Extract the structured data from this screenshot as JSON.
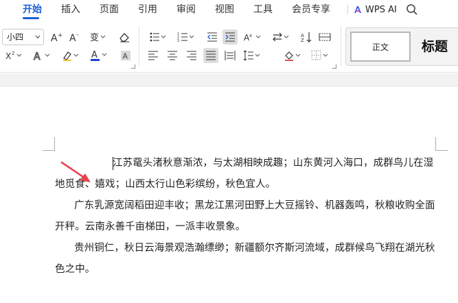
{
  "menu": {
    "tabs": [
      "开始",
      "插入",
      "页面",
      "引用",
      "审阅",
      "视图",
      "工具",
      "会员专享"
    ],
    "active_tab": "开始",
    "ai_label": "WPS AI"
  },
  "ribbon": {
    "font_size": "小四",
    "styles": {
      "normal": "正文",
      "heading": "标题"
    }
  },
  "document": {
    "paragraphs": [
      "江苏鼋头渚秋意渐浓，与太湖相映成趣；山东黄河入海口，成群鸟儿在湿地觅食、嬉戏；山西太行山色彩缤纷，秋色宜人。",
      "广东乳源宽阔稻田迎丰收；黑龙江黑河田野上大豆摇铃、机器轰鸣，秋粮收购全面开秤。云南永善千亩梯田，一派丰收景象。",
      "贵州铜仁，秋日云海景观浩瀚缥缈；新疆额尔齐斯河流域，成群候鸟飞翔在湖光秋色之中。"
    ]
  },
  "colors": {
    "accent": "#1a5fd6",
    "annotation_arrow": "#e8434f",
    "font_color_bar": "#1a3fd6"
  }
}
